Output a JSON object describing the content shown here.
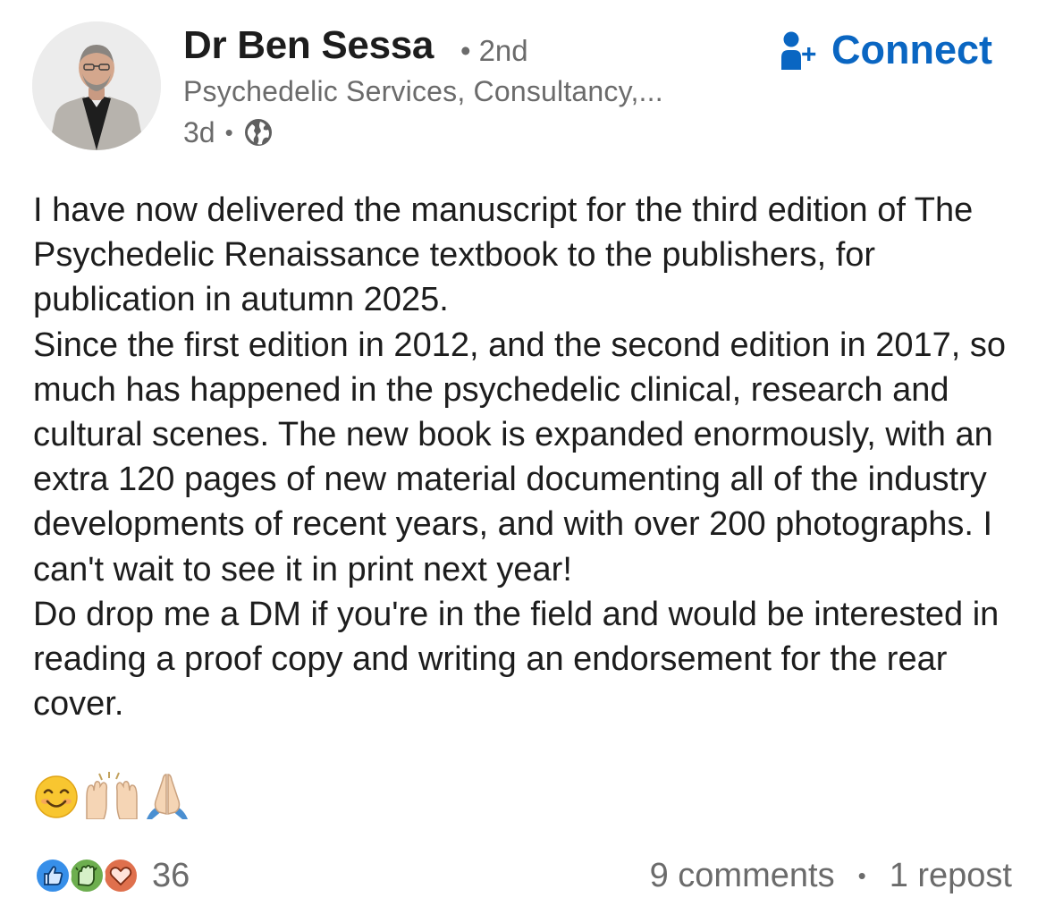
{
  "post": {
    "author": {
      "name": "Dr Ben Sessa",
      "degree_separator": "•",
      "degree": "2nd",
      "headline": "Psychedelic Services, Consultancy,...",
      "time": "3d",
      "meta_separator": "•",
      "visibility_icon": "globe-icon"
    },
    "connect_label": "Connect",
    "connect_icon": "person-add-icon",
    "body": [
      "I have now delivered the manuscript for the third edition of The Psychedelic Renaissance textbook to the publishers, for publication in autumn 2025.",
      "Since the first edition in 2012, and the second edition in 2017, so much has happened in the psychedelic clinical, research and cultural scenes. The new book is expanded enormously, with an extra 120 pages of new material documenting all of the industry developments of recent years, and with over 200 photographs. I can't wait to see it in print next year!",
      "Do drop me a DM if you're in the field and would be interested in reading a proof copy and writing an endorsement for the rear cover."
    ],
    "emojis": [
      "smiling-face-icon",
      "raising-hands-icon",
      "folded-hands-icon"
    ],
    "reactions": {
      "icons": [
        "like-icon",
        "celebrate-icon",
        "love-icon"
      ],
      "count": "36"
    },
    "comments_label": "9 comments",
    "social_separator": "•",
    "reposts_label": "1 repost"
  },
  "colors": {
    "accent": "#0a66c2",
    "text": "#1d1d1d",
    "muted": "#6b6b6b",
    "like": "#378fe9",
    "celebrate": "#44712e",
    "love": "#df704d"
  }
}
